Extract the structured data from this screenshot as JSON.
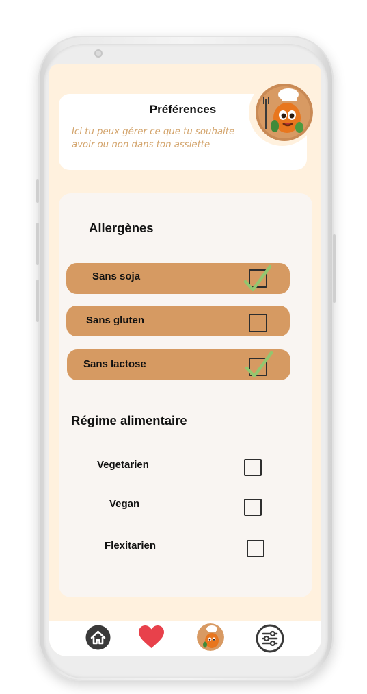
{
  "header": {
    "title": "Préférences",
    "subtitle": "Ici tu peux gérer ce que tu souhaite avoir ou non dans ton assiette"
  },
  "allergens": {
    "title": "Allergènes",
    "items": [
      {
        "label": "Sans soja",
        "checked": true
      },
      {
        "label": "Sans gluten",
        "checked": false
      },
      {
        "label": "Sans lactose",
        "checked": true
      }
    ]
  },
  "diet": {
    "title": "Régime alimentaire",
    "items": [
      {
        "label": "Vegetarien",
        "checked": false
      },
      {
        "label": "Vegan",
        "checked": false
      },
      {
        "label": "Flexitarien",
        "checked": false
      }
    ]
  },
  "nav": {
    "items": [
      "home-icon",
      "heart-icon",
      "chef-avatar-icon",
      "sliders-icon"
    ]
  },
  "colors": {
    "screen_bg": "#fff1de",
    "row_bg": "#d69a62",
    "subtitle": "#d3a46c",
    "check": "#93c66f",
    "heart": "#e8414b"
  }
}
